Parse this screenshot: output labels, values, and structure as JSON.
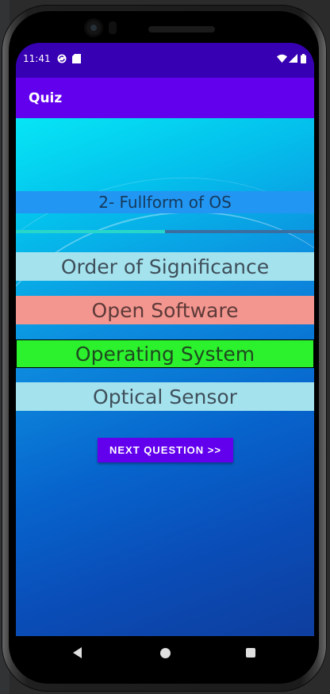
{
  "status_bar": {
    "time": "11:41"
  },
  "app_bar": {
    "title": "Quiz"
  },
  "quiz": {
    "question": "2- Fullform of OS",
    "progress": 0.5,
    "options": [
      {
        "label": "Order of Significance",
        "state": "neutral",
        "color": "#a4e3ee"
      },
      {
        "label": "Open Software",
        "state": "wrong",
        "color": "#f2968f"
      },
      {
        "label": "Operating System",
        "state": "correct",
        "color": "#2cf22e"
      },
      {
        "label": "Optical Sensor",
        "state": "neutral",
        "color": "#a4e3ee"
      }
    ],
    "next_button_label": "NEXT QUESTION >>"
  },
  "navigation_bar": {
    "icons": [
      "back-icon",
      "home-icon",
      "recents-icon"
    ]
  },
  "colors": {
    "primary": "#6200ee",
    "primary_dark": "#3700b3"
  }
}
